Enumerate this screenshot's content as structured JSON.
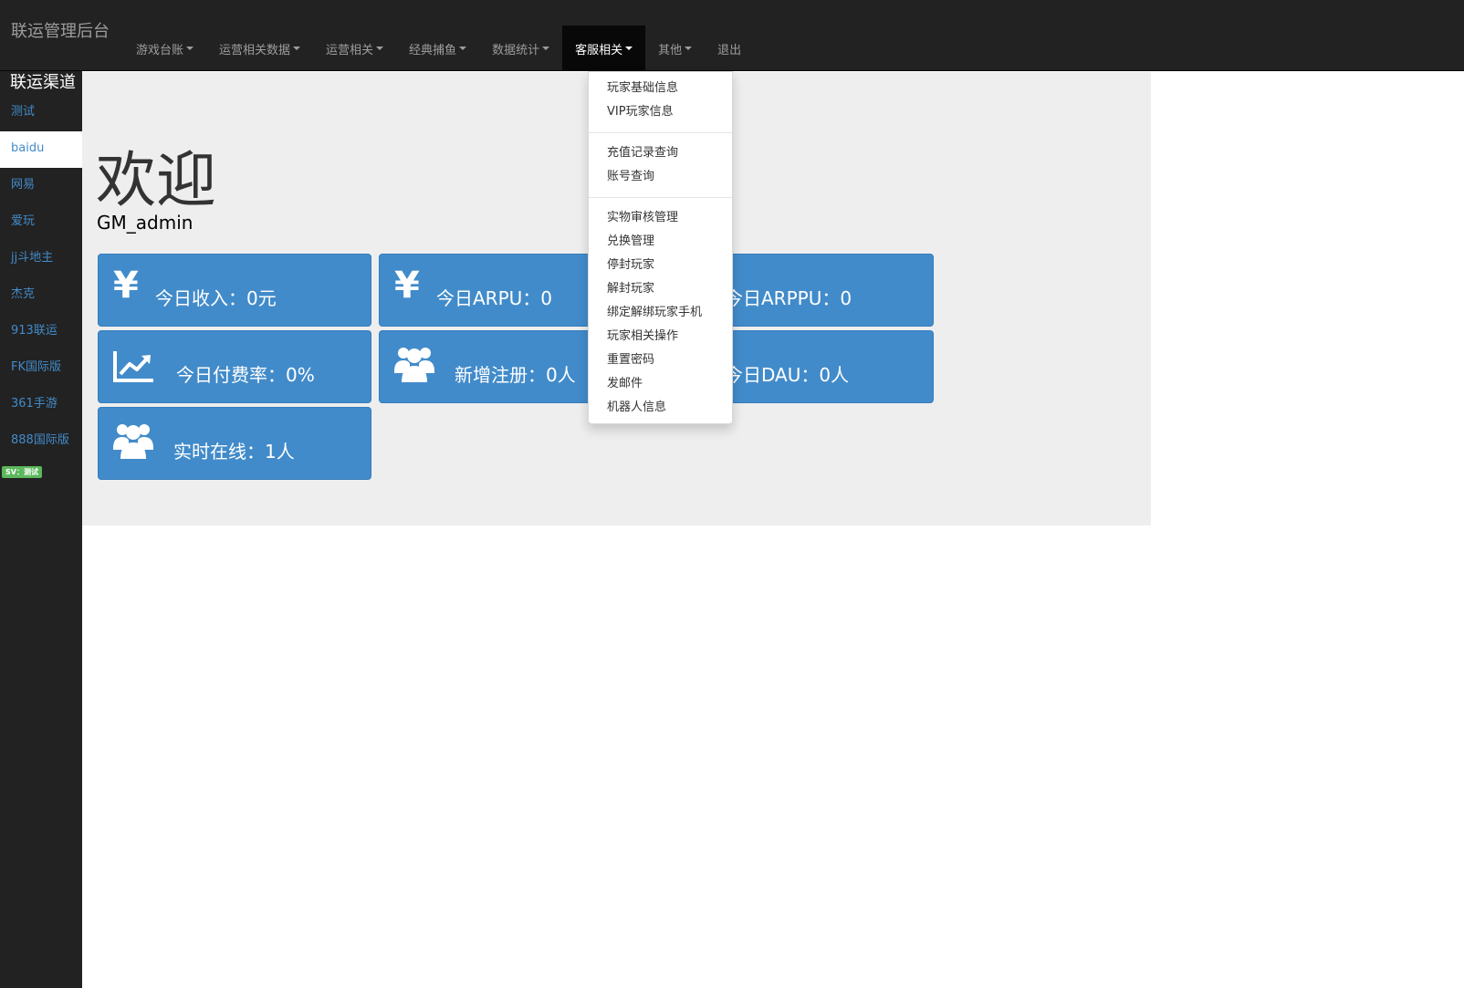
{
  "brand": "联运管理后台",
  "nav": [
    {
      "label": "游戏台账",
      "caret": true
    },
    {
      "label": "运营相关数据",
      "caret": true
    },
    {
      "label": "运营相关",
      "caret": true
    },
    {
      "label": "经典捕鱼",
      "caret": true
    },
    {
      "label": "数据统计",
      "caret": true
    },
    {
      "label": "客服相关",
      "caret": true,
      "active": true
    },
    {
      "label": "其他",
      "caret": true
    },
    {
      "label": "退出",
      "caret": false
    }
  ],
  "sidebar": {
    "title": "联运渠道",
    "items": [
      {
        "label": "测试"
      },
      {
        "label": "baidu",
        "active": true
      },
      {
        "label": "网易"
      },
      {
        "label": "爱玩"
      },
      {
        "label": "jj斗地主"
      },
      {
        "label": "杰克"
      },
      {
        "label": "913联运"
      },
      {
        "label": "FK国际版"
      },
      {
        "label": "361手游"
      },
      {
        "label": "888国际版"
      }
    ],
    "sv_badge": "SV：测试"
  },
  "welcome": {
    "title": "欢迎",
    "user": "GM_admin"
  },
  "cards": {
    "revenue": "今日收入：0元",
    "arpu": "今日ARPU：0",
    "arppu": "今日ARPPU：0",
    "pay_rate": "今日付费率：0%",
    "new_reg": "新增注册：0人",
    "dau": "今日DAU：0人",
    "online": "实时在线：1人"
  },
  "dropdown": {
    "group1": [
      "玩家基础信息",
      "VIP玩家信息"
    ],
    "group2": [
      "充值记录查询",
      "账号查询"
    ],
    "group3": [
      "实物审核管理",
      "兑换管理",
      "停封玩家",
      "解封玩家",
      "绑定解绑玩家手机",
      "玩家相关操作",
      "重置密码",
      "发邮件",
      "机器人信息"
    ]
  },
  "colors": {
    "navbar_bg": "#222222",
    "card_bg": "#428bca",
    "link": "#428bca",
    "jumbotron_bg": "#eeeeee",
    "badge_green": "#5cb85c"
  },
  "icons": {
    "revenue": "yen-icon",
    "arpu": "yen-icon",
    "pay_rate": "line-chart-icon",
    "new_reg": "users-icon",
    "online": "users-icon"
  }
}
